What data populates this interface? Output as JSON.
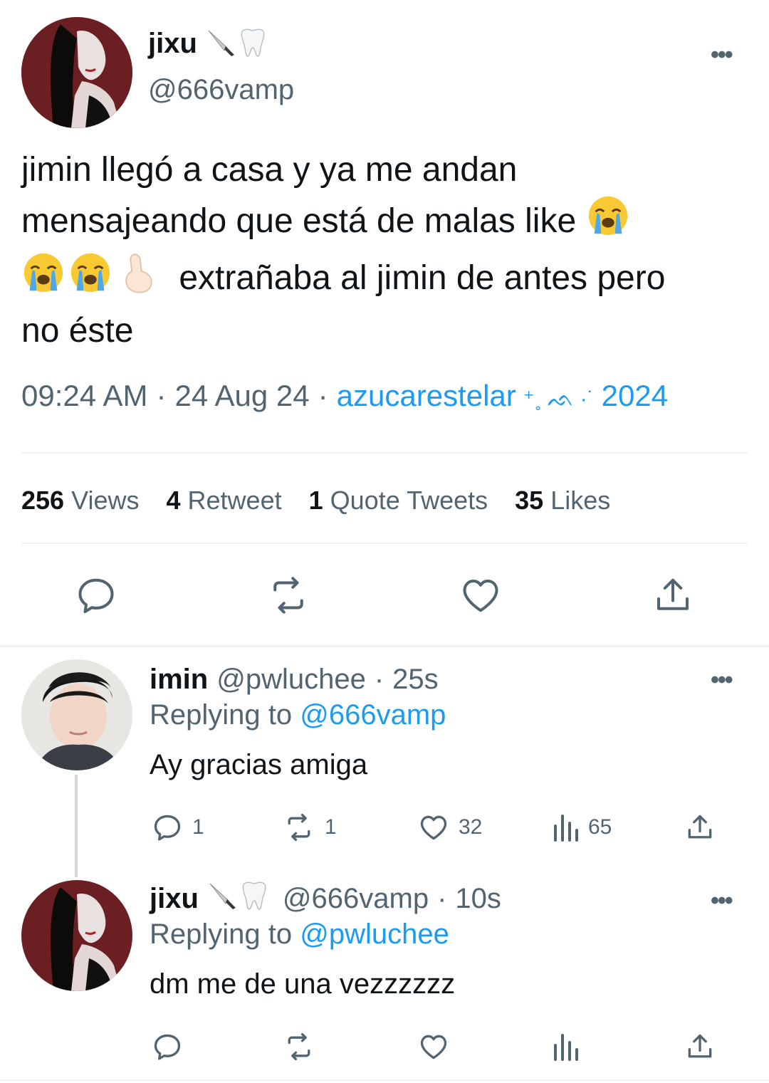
{
  "main_tweet": {
    "display_name": "jixu",
    "name_emojis": "🔪🦷",
    "handle": "@666vamp",
    "more_label": "•••",
    "text_line1": "jimin llegó a casa y ya me andan",
    "text_line2": "mensajeando que está de malas like",
    "text_line3": "extrañaba al jimin de antes pero",
    "text_line4": "no éste",
    "time": "09:24 AM",
    "sep": "·",
    "date": "24 Aug 24",
    "source": "azucarestelar",
    "source_deco": "⁺˳ ᨒ ·˙",
    "source_year": "2024",
    "stats": [
      {
        "count": "256",
        "label": "Views"
      },
      {
        "count": "4",
        "label": "Retweet"
      },
      {
        "count": "1",
        "label": "Quote Tweets"
      },
      {
        "count": "35",
        "label": "Likes"
      }
    ]
  },
  "replies": [
    {
      "display_name": "imin",
      "handle": "@pwluchee",
      "sep": "·",
      "time": "25s",
      "replying_label": "Replying to",
      "replying_to": "@666vamp",
      "text": "Ay gracias amiga",
      "reply_count": "1",
      "retweet_count": "1",
      "like_count": "32",
      "views_count": "65"
    },
    {
      "display_name": "jixu",
      "handle": "@666vamp",
      "sep": "·",
      "time": "10s",
      "replying_label": "Replying to",
      "replying_to": "@pwluchee",
      "text": "dm me de una vezzzzzz",
      "reply_count": "",
      "retweet_count": "",
      "like_count": "",
      "views_count": ""
    }
  ],
  "colors": {
    "link": "#1d9bf0",
    "muted": "#536471",
    "text": "#0f1419",
    "divider": "#eff3f4"
  }
}
